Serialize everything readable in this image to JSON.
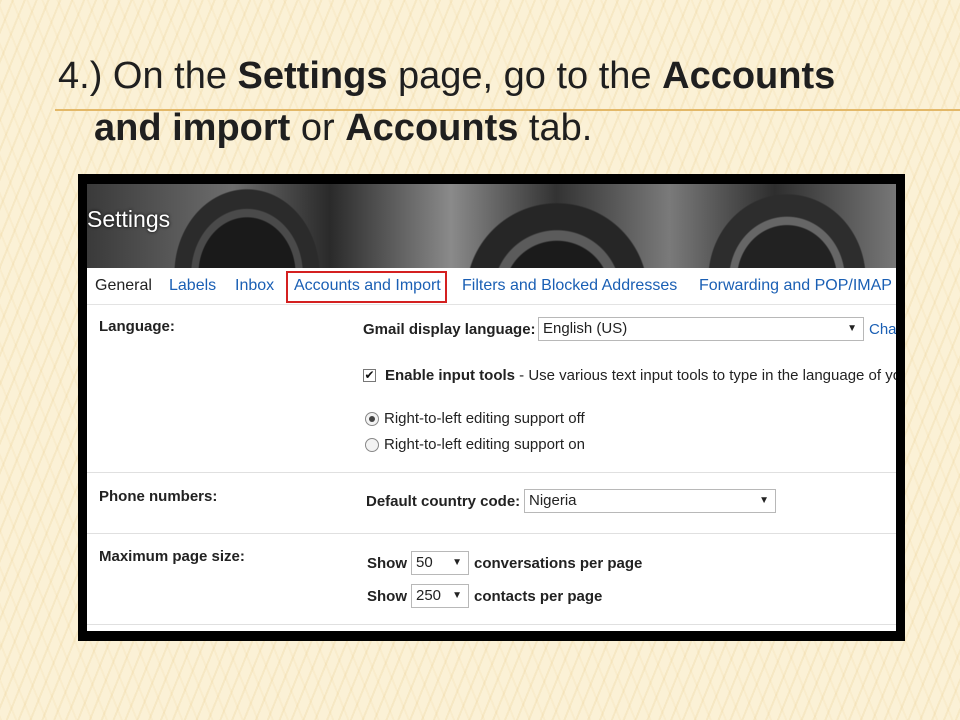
{
  "slide": {
    "title_prefix": "4.) On the ",
    "title_settings": "Settings",
    "title_mid": " page, go to the ",
    "title_accounts1": "Accounts",
    "title_and_import": "and import",
    "title_or": " or ",
    "title_accounts2": "Accounts",
    "title_suffix": " tab."
  },
  "banner": {
    "title": "Settings"
  },
  "tabs": {
    "general": "General",
    "labels": "Labels",
    "inbox": "Inbox",
    "accounts": "Accounts and Import",
    "filters": "Filters and Blocked Addresses",
    "forwarding": "Forwarding and POP/IMAP",
    "highlight_color": "#d42020"
  },
  "language": {
    "label": "Language:",
    "display_label": "Gmail display language:",
    "display_value": "English (US)",
    "change_link": "Cha",
    "input_tools_bold": "Enable input tools",
    "input_tools_desc": " - Use various text input tools to type in the language of yo",
    "input_tools_checked": true,
    "rtl_off": "Right-to-left editing support off",
    "rtl_on": "Right-to-left editing support on",
    "rtl_selected": "off"
  },
  "phone": {
    "label": "Phone numbers:",
    "country_label": "Default country code:",
    "country_value": "Nigeria"
  },
  "page_size": {
    "label": "Maximum page size:",
    "show": "Show",
    "conversations_value": "50",
    "conversations_text": "conversations per page",
    "contacts_value": "250",
    "contacts_text": "contacts per page"
  }
}
